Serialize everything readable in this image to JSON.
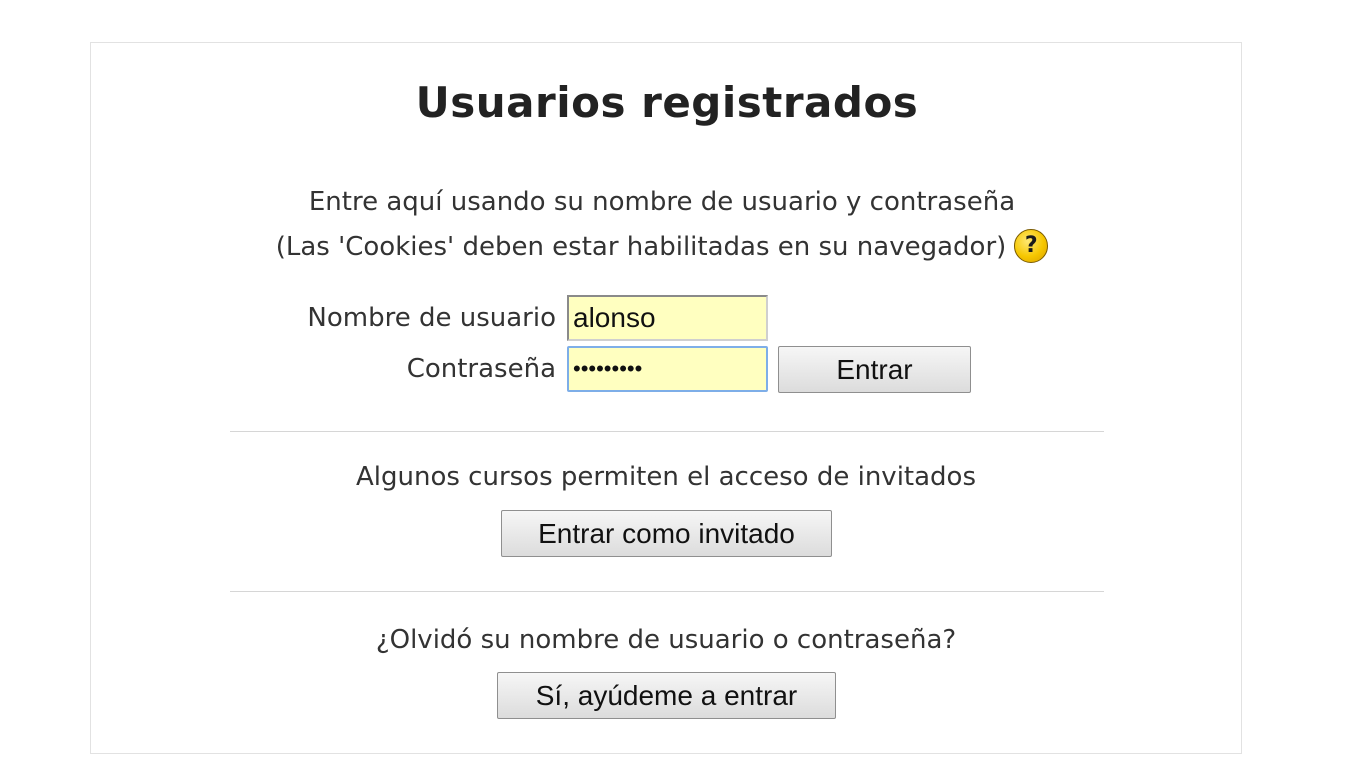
{
  "login": {
    "title": "Usuarios registrados",
    "intro_line1": "Entre aquí usando su nombre de usuario y contraseña",
    "intro_line2": "(Las 'Cookies' deben estar habilitadas en su navegador)",
    "help_icon": "help-question-icon",
    "help_glyph": "?",
    "username_label": "Nombre de usuario",
    "username_value": "alonso",
    "password_label": "Contraseña",
    "password_value": "•••••••••",
    "submit_label": "Entrar"
  },
  "guest": {
    "note": "Algunos cursos permiten el acceso de invitados",
    "button_label": "Entrar como invitado"
  },
  "forgot": {
    "note": "¿Olvidó su nombre de usuario o contraseña?",
    "button_label": "Sí, ayúdeme a entrar"
  },
  "colors": {
    "field_background": "#ffffc0",
    "focus_border": "#7eaee8",
    "help_icon": "#f6c700"
  }
}
